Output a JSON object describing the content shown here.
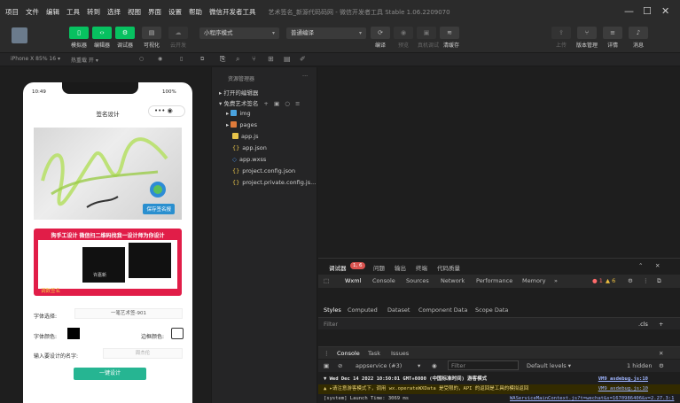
{
  "menubar": {
    "items": [
      "项目",
      "文件",
      "编辑",
      "工具",
      "转到",
      "选择",
      "视图",
      "界面",
      "设置",
      "帮助",
      "微信开发者工具"
    ],
    "title": "艺术签名_新源代码码网 - 微信开发者工具 Stable 1.06.2209070",
    "min": "—",
    "max": "☐",
    "close": "✕"
  },
  "toolbar": {
    "buttons": [
      "模拟器",
      "编辑器",
      "调试器",
      "可视化",
      "云开发"
    ],
    "mode": "小程序模式",
    "compile": "普通编译",
    "actions": [
      "编译",
      "预览",
      "真机调试",
      "清缓存"
    ],
    "right": [
      "上传",
      "版本管理",
      "详情",
      "消息"
    ]
  },
  "subbar": {
    "device": "iPhone X 85% 16 ▾",
    "hot": "热重载 开 ▾"
  },
  "explorer": {
    "title": "资源管理器",
    "more": "···",
    "open_editors": "打开的编辑器",
    "project": "免费艺术签名",
    "items": [
      {
        "name": "img",
        "color": "#4aa3df",
        "folder": true
      },
      {
        "name": "pages",
        "color": "#e07b3a",
        "folder": true
      },
      {
        "name": "app.js",
        "color": "#e6c34a",
        "folder": false
      },
      {
        "name": "app.json",
        "color": "#e6c34a",
        "folder": false
      },
      {
        "name": "app.wxss",
        "color": "#4a8fe6",
        "folder": false
      },
      {
        "name": "project.config.json",
        "color": "#e6c34a",
        "folder": false
      },
      {
        "name": "project.private.config.js...",
        "color": "#e6c34a",
        "folder": false
      }
    ]
  },
  "phone": {
    "time": "10:49",
    "battery": "100%",
    "nav_title": "签名设计",
    "capsule": "•••  ◉",
    "save_btn": "保存签名报",
    "ad_title": "狗手工设计 微信扫二维码找我一设计师为你设计",
    "ad_foot": "调数签名",
    "ad_name": "许嘉新",
    "font_label": "字体选择:",
    "font_value": "一笔艺术签-901",
    "color_label": "字体颜色:",
    "border_label": "边框颜色:",
    "name_label": "输入要设计的名字:",
    "name_placeholder": "周杰伦",
    "gen_btn": "一键设计"
  },
  "debugger": {
    "tabs": [
      "调试器",
      "问题",
      "输出",
      "终端",
      "代码质量"
    ],
    "badge": "1, 6",
    "subtabs": [
      "Wxml",
      "Console",
      "Sources",
      "Network",
      "Performance",
      "Memory",
      "»"
    ],
    "errors": "● 1",
    "warnings": "▲ 6",
    "styles_tabs": [
      "Styles",
      "Computed",
      "Dataset",
      "Component Data",
      "Scope Data"
    ],
    "filter": "Filter",
    "cls": ".cls",
    "plus": "+",
    "drawer_tabs": [
      "Console",
      "Task",
      "Issues"
    ],
    "context": "appservice (#3)",
    "filter_placeholder": "Filter",
    "levels": "Default levels ▾",
    "hidden": "1 hidden",
    "lines": [
      {
        "text": "▼ Wed Dec 14 2022 10:50:01 GMT+0800 (中国标准时间) 游客模式",
        "src": "VM9 asdebug.js:10",
        "color": "#e8e8e8",
        "bg": "#1e1e1e",
        "bold": true
      },
      {
        "text": "▲ ▸请注意游客模式下，调用 wx.operateWXData 是受限的，API 的返回是工具的模拟返回",
        "src": "VM9 asdebug.js:10",
        "color": "#e8d27a",
        "bg": "#332b00",
        "bold": false
      },
      {
        "text": "  [system] Launch Time: 3069 ms",
        "src": "WAServiceMainContext.js?t=wechat&s=1670986406&v=2.27.3:1",
        "color": "#d0d0d0",
        "bg": "#1e1e1e",
        "bold": false
      }
    ]
  },
  "colors": {
    "accent": "#07c160",
    "gen_button": "#26b592",
    "ad_red": "#e11d48",
    "badge": "#d9534f"
  }
}
